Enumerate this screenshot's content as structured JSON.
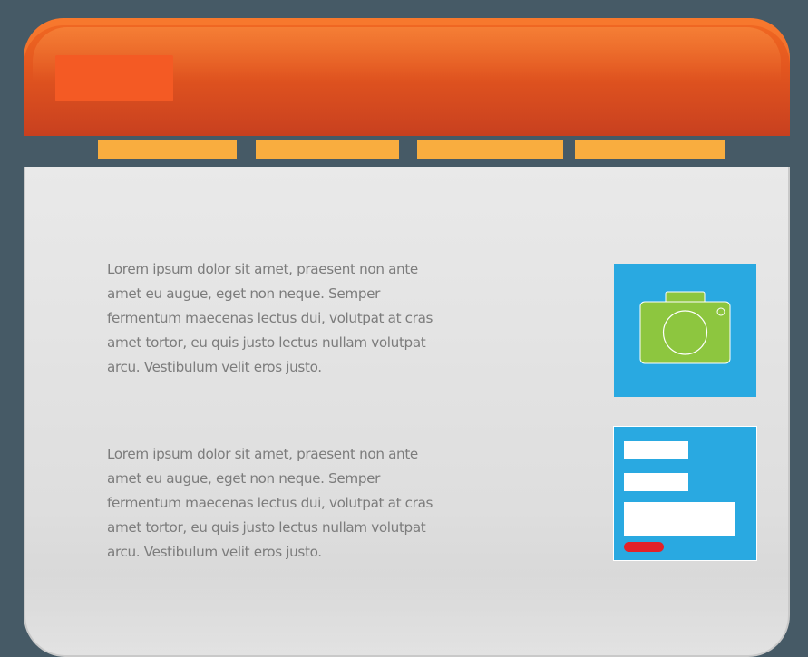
{
  "header": {
    "logo": "logo-block"
  },
  "nav": {
    "tabs": [
      {
        "label": ""
      },
      {
        "label": ""
      },
      {
        "label": ""
      },
      {
        "label": ""
      }
    ]
  },
  "content": {
    "paragraphs": [
      "Lorem ipsum dolor sit amet, praesent non ante amet eu augue, eget non neque. Semper fermentum maecenas lectus dui, volutpat at cras amet tortor, eu quis justo lectus nullam volutpat arcu. Vestibulum velit eros justo.",
      "Lorem ipsum dolor sit amet, praesent non ante amet eu augue, eget non neque. Semper fermentum maecenas lectus dui, volutpat at cras amet tortor, eu quis justo lectus nullam volutpat arcu. Vestibulum velit eros justo."
    ],
    "photo_widget": {
      "icon": "camera-icon"
    },
    "form_widget": {
      "fields": [
        "",
        "",
        ""
      ],
      "submit_label": ""
    }
  },
  "colors": {
    "background": "#465a66",
    "header": "#e2551f",
    "logo": "#f45a24",
    "tab": "#f9ad3f",
    "content": "#e2e2e2",
    "widget": "#29a9e1",
    "camera": "#8dc63f",
    "submit": "#e32128",
    "text": "#7c7c7c"
  }
}
